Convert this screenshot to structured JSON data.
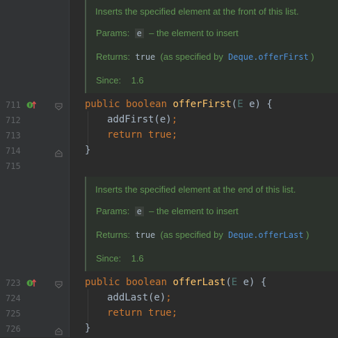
{
  "gutter": {
    "line_numbers": [
      "711",
      "712",
      "713",
      "714",
      "715",
      "723",
      "724",
      "725",
      "726"
    ]
  },
  "doc1": {
    "summary": "Inserts the specified element at the front of this list.",
    "params_label": "Params:",
    "param_name": "e",
    "param_desc": "– the element to insert",
    "returns_label": "Returns:",
    "returns_value": "true",
    "returns_prefix": "(as specified by",
    "returns_link": "Deque.offerFirst",
    "returns_suffix": ")",
    "since_label": "Since:",
    "since_value": "1.6"
  },
  "doc2": {
    "summary": "Inserts the specified element at the end of this list.",
    "params_label": "Params:",
    "param_name": "e",
    "param_desc": "– the element to insert",
    "returns_label": "Returns:",
    "returns_value": "true",
    "returns_prefix": "(as specified by",
    "returns_link": "Deque.offerLast",
    "returns_suffix": ")",
    "since_label": "Since:",
    "since_value": "1.6"
  },
  "method1": {
    "kw_public": "public",
    "kw_boolean": "boolean",
    "name": "offerFirst",
    "open_paren": "(",
    "param_type": "E",
    "param_name": " e) {",
    "body_call": "addFirst(e)",
    "body_call_semi": ";",
    "kw_return": "return",
    "kw_true": "true",
    "ret_semi": ";",
    "close": "}"
  },
  "method2": {
    "kw_public": "public",
    "kw_boolean": "boolean",
    "name": "offerLast",
    "open_paren": "(",
    "param_type": "E",
    "param_name": " e) {",
    "body_call": "addLast(e)",
    "body_call_semi": ";",
    "kw_return": "return",
    "kw_true": "true",
    "ret_semi": ";",
    "close": "}"
  },
  "colors": {
    "background": "#2b2b2b",
    "gutter": "#313335",
    "doc_text": "#629755",
    "keyword": "#cc7832",
    "method_name": "#ffc66d",
    "default_text": "#a9b7c6",
    "link": "#4f8fd6"
  }
}
